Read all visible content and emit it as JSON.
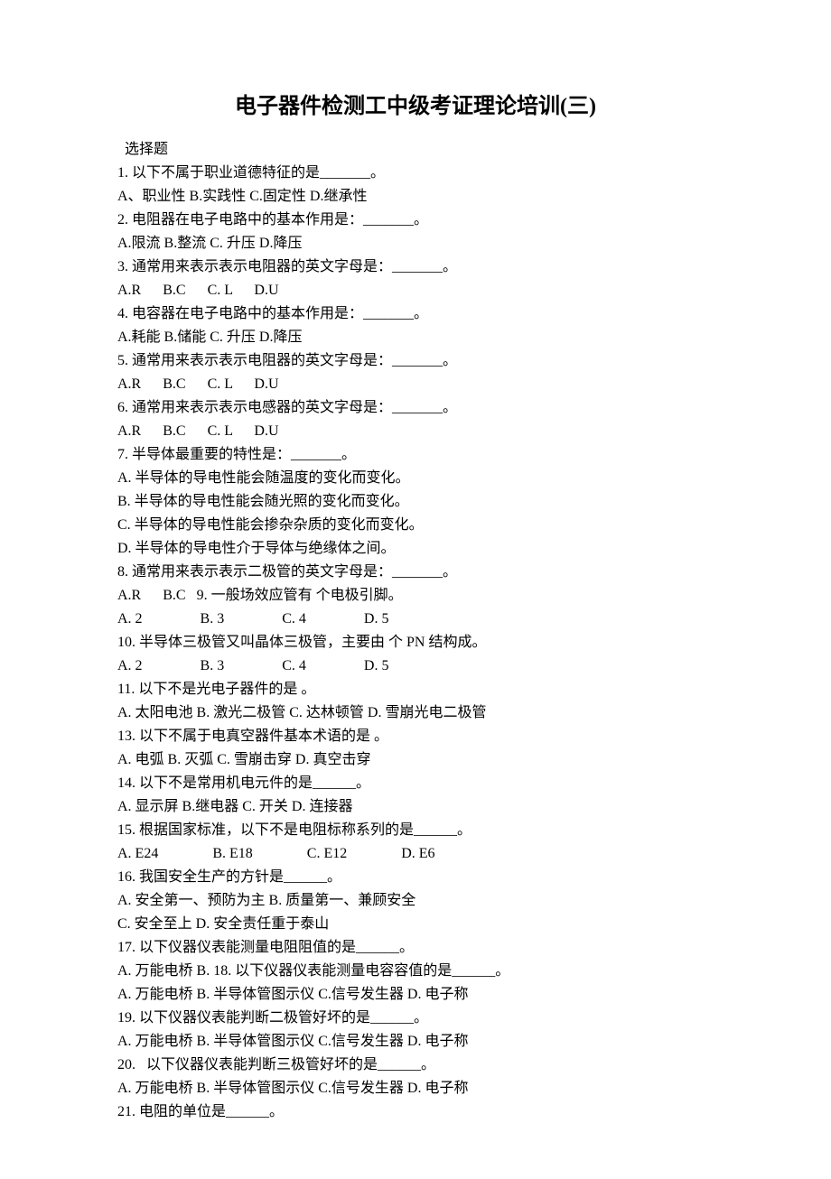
{
  "title": "电子器件检测工中级考证理论培训(三)",
  "sectionLabel": "选择题",
  "lines": [
    "1. 以下不属于职业道德特征的是_______。",
    "A、职业性 B.实践性 C.固定性 D.继承性",
    "2. 电阻器在电子电路中的基本作用是：_______。",
    "A.限流 B.整流 C. 升压 D.降压",
    "3. 通常用来表示表示电阻器的英文字母是：_______。",
    "A.R      B.C      C. L      D.U",
    "4. 电容器在电子电路中的基本作用是：_______。",
    "A.耗能 B.储能 C. 升压 D.降压",
    "5. 通常用来表示表示电阻器的英文字母是：_______。",
    "A.R      B.C      C. L      D.U",
    "6. 通常用来表示表示电感器的英文字母是：_______。",
    "A.R      B.C      C. L      D.U",
    "7. 半导体最重要的特性是：_______。",
    "A. 半导体的导电性能会随温度的变化而变化。",
    "B. 半导体的导电性能会随光照的变化而变化。",
    "C. 半导体的导电性能会掺杂杂质的变化而变化。",
    "D. 半导体的导电性介于导体与绝缘体之间。",
    "8. 通常用来表示表示二极管的英文字母是：_______。",
    "A.R      B.C   9. 一般场效应管有 个电极引脚。",
    "A. 2                B. 3                C. 4                D. 5",
    "10. 半导体三极管又叫晶体三极管，主要由 个 PN 结构成。",
    "A. 2                B. 3                C. 4                D. 5",
    "11. 以下不是光电子器件的是 。",
    "A. 太阳电池 B. 激光二极管 C. 达林顿管 D. 雪崩光电二极管",
    "13. 以下不属于电真空器件基本术语的是 。",
    "A. 电弧 B. 灭弧 C. 雪崩击穿 D. 真空击穿",
    "14. 以下不是常用机电元件的是______。",
    "A. 显示屏 B.继电器 C. 开关 D. 连接器",
    "15. 根据国家标准，以下不是电阻标称系列的是______。",
    "A. E24               B. E18               C. E12               D. E6",
    "16. 我国安全生产的方针是______。",
    "A. 安全第一、预防为主 B. 质量第一、兼顾安全",
    "C. 安全至上 D. 安全责任重于泰山",
    "17. 以下仪器仪表能测量电阻阻值的是______。",
    "A. 万能电桥 B. 18. 以下仪器仪表能测量电容容值的是______。",
    "A. 万能电桥 B. 半导体管图示仪 C.信号发生器 D. 电子称",
    "19. 以下仪器仪表能判断二极管好坏的是______。",
    "A. 万能电桥 B. 半导体管图示仪 C.信号发生器 D. 电子称",
    "20.   以下仪器仪表能判断三极管好坏的是______。",
    "A. 万能电桥 B. 半导体管图示仪 C.信号发生器 D. 电子称",
    "21. 电阻的单位是______。"
  ]
}
